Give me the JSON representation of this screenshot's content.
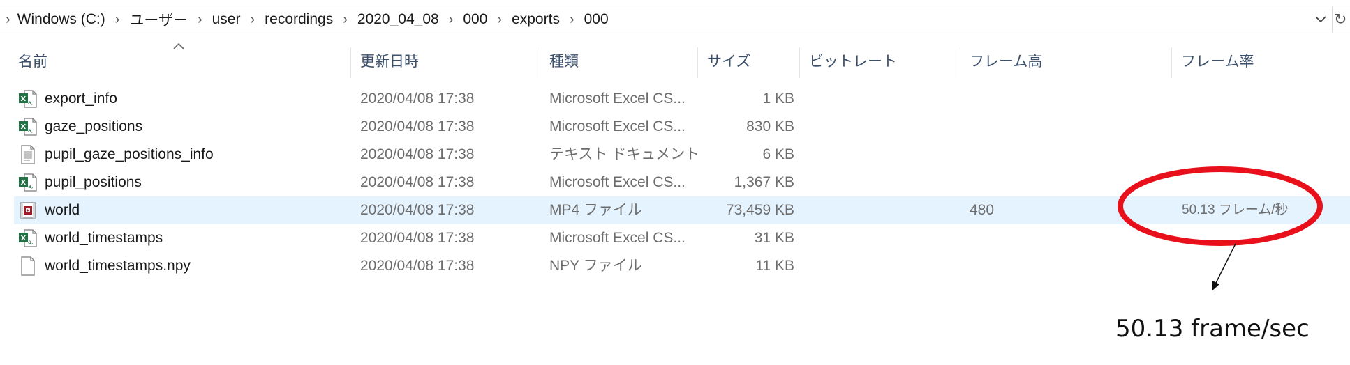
{
  "breadcrumb": {
    "items": [
      "Windows (C:)",
      "ユーザー",
      "user",
      "recordings",
      "2020_04_08",
      "000",
      "exports",
      "000"
    ]
  },
  "columns": {
    "name": "名前",
    "modified": "更新日時",
    "type": "種類",
    "size": "サイズ",
    "bitrate": "ビットレート",
    "frame_height": "フレーム高",
    "frame_rate": "フレーム率"
  },
  "files": [
    {
      "name": "export_info",
      "modified": "2020/04/08 17:38",
      "type": "Microsoft Excel CS...",
      "size": "1 KB",
      "frame_height": "",
      "frame_rate": "",
      "icon": "excel-csv-icon"
    },
    {
      "name": "gaze_positions",
      "modified": "2020/04/08 17:38",
      "type": "Microsoft Excel CS...",
      "size": "830 KB",
      "frame_height": "",
      "frame_rate": "",
      "icon": "excel-csv-icon"
    },
    {
      "name": "pupil_gaze_positions_info",
      "modified": "2020/04/08 17:38",
      "type": "テキスト ドキュメント",
      "size": "6 KB",
      "frame_height": "",
      "frame_rate": "",
      "icon": "text-document-icon"
    },
    {
      "name": "pupil_positions",
      "modified": "2020/04/08 17:38",
      "type": "Microsoft Excel CS...",
      "size": "1,367 KB",
      "frame_height": "",
      "frame_rate": "",
      "icon": "excel-csv-icon"
    },
    {
      "name": "world",
      "modified": "2020/04/08 17:38",
      "type": "MP4 ファイル",
      "size": "73,459 KB",
      "frame_height": "480",
      "frame_rate": "50.13 フレーム/秒",
      "icon": "video-file-icon",
      "selected": true
    },
    {
      "name": "world_timestamps",
      "modified": "2020/04/08 17:38",
      "type": "Microsoft Excel CS...",
      "size": "31 KB",
      "frame_height": "",
      "frame_rate": "",
      "icon": "excel-csv-icon"
    },
    {
      "name": "world_timestamps.npy",
      "modified": "2020/04/08 17:38",
      "type": "NPY ファイル",
      "size": "11 KB",
      "frame_height": "",
      "frame_rate": "",
      "icon": "blank-file-icon"
    }
  ],
  "annotation": {
    "label": "50.13 frame/sec",
    "color": "#e8101a"
  },
  "icons": {
    "dropdown": "chevron-down-icon",
    "refresh": "refresh-icon",
    "sort": "sort-ascending-icon",
    "separator": "chevron-right-icon"
  }
}
